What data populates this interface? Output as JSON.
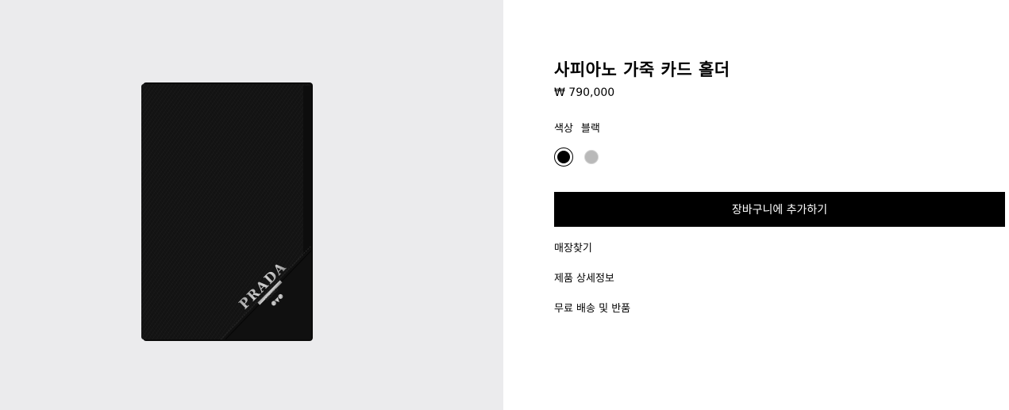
{
  "product": {
    "title": "사피아노 가죽 카드 홀더",
    "price": "₩ 790,000",
    "image": {
      "logo_text": "PRADA"
    }
  },
  "color": {
    "label": "색상",
    "value": "블랙",
    "swatches": [
      {
        "name": "블랙",
        "hex": "#000000",
        "selected": true
      },
      {
        "name": "실버",
        "hex": "#b9b9b9",
        "selected": false
      }
    ]
  },
  "cart": {
    "button_label": "장바구니에 추가하기"
  },
  "links": {
    "store_finder": "매장찾기",
    "product_details": "제품 상세정보",
    "shipping_returns": "무료 배송 및 반품"
  },
  "colors": {
    "image_background": "#ebebed",
    "button_background": "#000000",
    "button_text": "#ffffff",
    "swatch_silver": "#b9b9b9"
  }
}
